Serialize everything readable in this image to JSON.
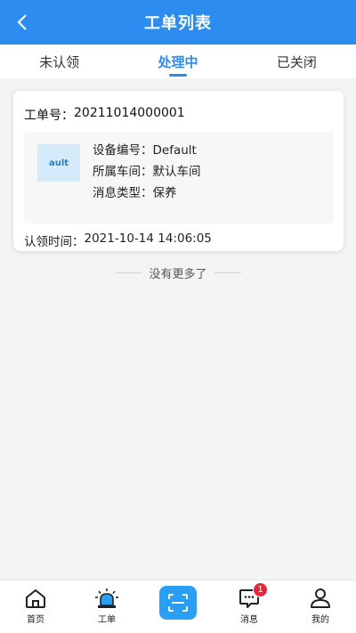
{
  "header": {
    "title": "工单列表"
  },
  "tabs": [
    {
      "label": "未认领"
    },
    {
      "label": "处理中",
      "active": true
    },
    {
      "label": "已关闭"
    }
  ],
  "card": {
    "order_label": "工单号：",
    "order_no": "20211014000001",
    "thumb_text": "ault",
    "device_label": "设备编号：",
    "device_value": "Default",
    "workshop_label": "所属车间：",
    "workshop_value": "默认车间",
    "msgtype_label": "消息类型：",
    "msgtype_value": "保养",
    "claim_label": "认领时间：",
    "claim_value": "2021-10-14 14:06:05"
  },
  "list_end_text": "没有更多了",
  "tabbar": {
    "home": "首页",
    "workorder": "工单",
    "message": "消息",
    "message_badge": "1",
    "mine": "我的"
  },
  "colors": {
    "primary": "#2d8cf0",
    "scan": "#2a9df4",
    "badge": "#e8263b"
  },
  "icons": {
    "back": "chevron-left-icon",
    "home": "home-icon",
    "workorder": "alarm-light-icon",
    "scan": "scan-icon",
    "message": "chat-icon",
    "mine": "user-icon"
  }
}
